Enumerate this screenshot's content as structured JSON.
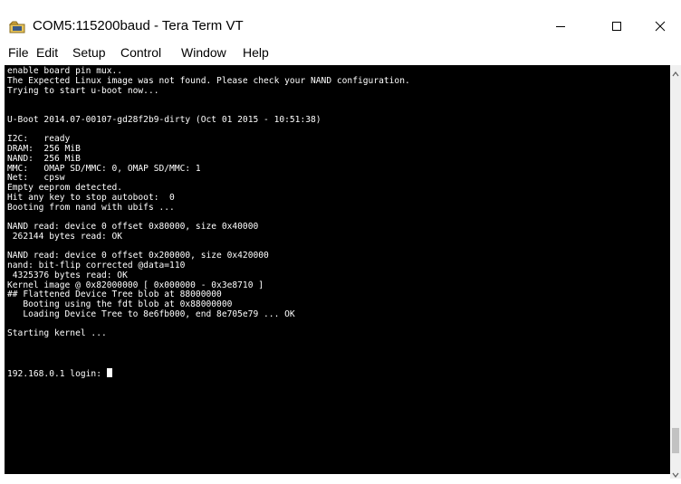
{
  "window": {
    "title": "COM5:115200baud - Tera Term VT",
    "icon": "tera-term-icon",
    "controls": [
      "minimize-icon",
      "maximize-icon",
      "close-icon"
    ]
  },
  "menu": [
    {
      "label": "File"
    },
    {
      "label": "Edit"
    },
    {
      "label": "Setup"
    },
    {
      "label": "Control"
    },
    {
      "label": "Window"
    },
    {
      "label": "Help"
    }
  ],
  "terminal": {
    "lines": [
      "enable board pin mux..",
      "The Expected Linux image was not found. Please check your NAND configuration.",
      "Trying to start u-boot now...",
      "",
      "",
      "U-Boot 2014.07-00107-gd28f2b9-dirty (Oct 01 2015 - 10:51:38)",
      "",
      "I2C:   ready",
      "DRAM:  256 MiB",
      "NAND:  256 MiB",
      "MMC:   OMAP SD/MMC: 0, OMAP SD/MMC: 1",
      "Net:   cpsw",
      "Empty eeprom detected.",
      "Hit any key to stop autoboot:  0",
      "Booting from nand with ubifs ...",
      "",
      "NAND read: device 0 offset 0x80000, size 0x40000",
      " 262144 bytes read: OK",
      "",
      "NAND read: device 0 offset 0x200000, size 0x420000",
      "nand: bit-flip corrected @data=110",
      " 4325376 bytes read: OK",
      "Kernel image @ 0x82000000 [ 0x000000 - 0x3e8710 ]",
      "## Flattened Device Tree blob at 88000000",
      "   Booting using the fdt blob at 0x88000000",
      "   Loading Device Tree to 8e6fb000, end 8e705e79 ... OK",
      "",
      "Starting kernel ...",
      "",
      "",
      ""
    ],
    "prompt": "192.168.0.1 login: "
  },
  "scrollbar": {
    "position_fraction": 0.96
  }
}
